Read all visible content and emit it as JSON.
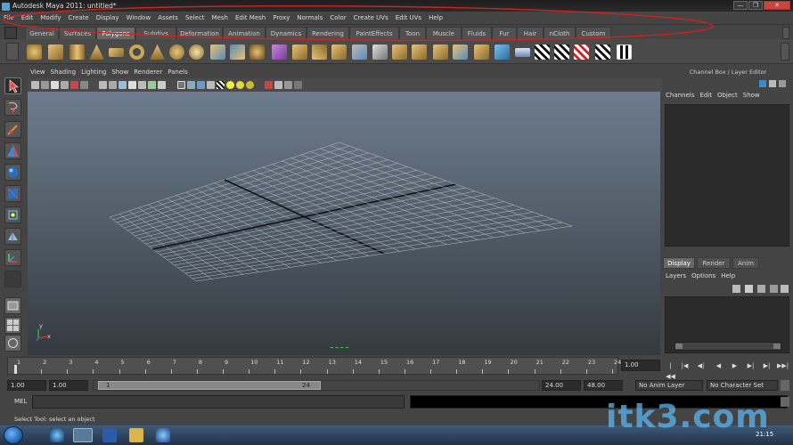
{
  "window": {
    "title": "Autodesk Maya 2011: untitled*",
    "minimize_glyph": "—",
    "maximize_glyph": "❐",
    "close_glyph": "✕"
  },
  "menu": [
    "File",
    "Edit",
    "Modify",
    "Create",
    "Display",
    "Window",
    "Assets",
    "Select",
    "Mesh",
    "Edit Mesh",
    "Proxy",
    "Normals",
    "Color",
    "Create UVs",
    "Edit UVs",
    "Help"
  ],
  "shelf_tabs": [
    "General",
    "Surfaces",
    "Polygons",
    "Subdivs",
    "Deformation",
    "Animation",
    "Dynamics",
    "Rendering",
    "PaintEffects",
    "Toon",
    "Muscle",
    "Fluids",
    "Fur",
    "Hair",
    "nCloth",
    "Custom"
  ],
  "shelf_active": "Polygons",
  "viewport": {
    "menu": [
      "View",
      "Shading",
      "Lighting",
      "Show",
      "Renderer",
      "Panels"
    ],
    "axis_x": "x",
    "axis_y": "y"
  },
  "channel_box": {
    "title": "Channel Box / Layer Editor",
    "menu": [
      "Channels",
      "Edit",
      "Object",
      "Show"
    ]
  },
  "layer_editor": {
    "tabs": [
      "Display",
      "Render",
      "Anim"
    ],
    "active_tab": "Display",
    "menu": [
      "Layers",
      "Options",
      "Help"
    ]
  },
  "time_slider": {
    "ticks": [
      "1",
      "2",
      "3",
      "4",
      "5",
      "6",
      "7",
      "8",
      "9",
      "10",
      "11",
      "12",
      "13",
      "14",
      "15",
      "16",
      "17",
      "18",
      "19",
      "20",
      "21",
      "22",
      "23",
      "24"
    ],
    "current_frame": "1.00"
  },
  "range_slider": {
    "start": "1.00",
    "playback_start": "1.00",
    "bar_start": "1",
    "bar_end": "24",
    "playback_end": "24.00",
    "end": "48.00",
    "anim_layer": "No Anim Layer",
    "character_set": "No Character Set"
  },
  "command_line": {
    "label": "MEL"
  },
  "help_line": "Select Tool: select an object",
  "taskbar": {
    "clock": "21:15"
  },
  "watermark": "itk3.com",
  "colors": {
    "annotation": "#d42020",
    "watermark": "#5cb4f0",
    "viewport_top": "#6d7c8e",
    "viewport_bottom": "#343a3f"
  }
}
